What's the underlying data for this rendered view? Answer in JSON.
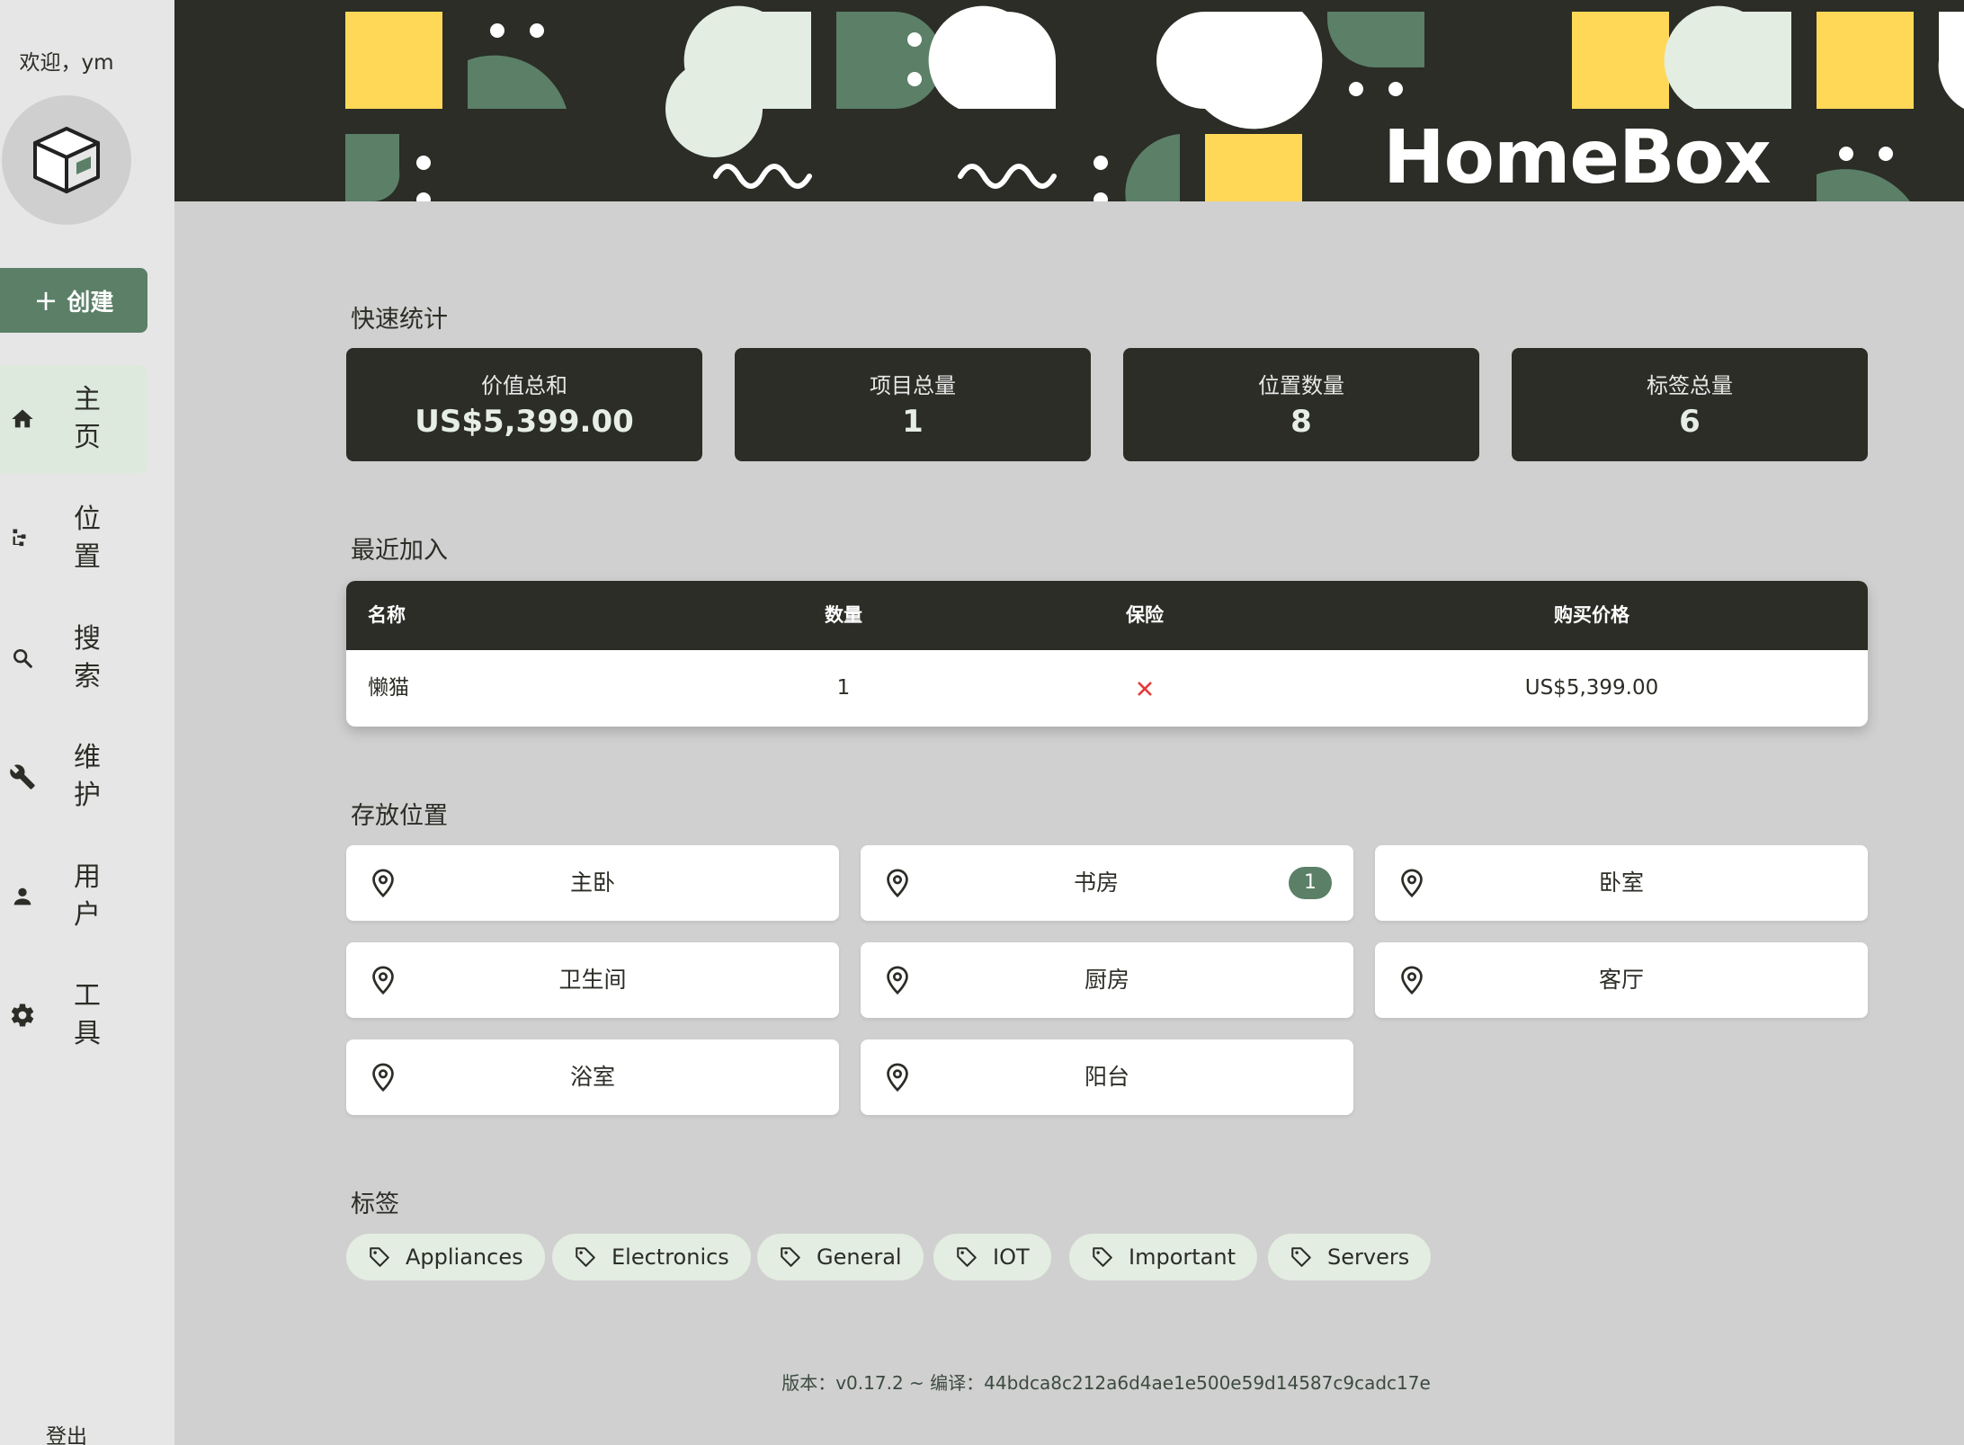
{
  "sidebar": {
    "welcome": "欢迎，ym",
    "create_label": "创建",
    "nav": [
      {
        "label": "主页",
        "icon": "home-icon",
        "active": true
      },
      {
        "label": "位置",
        "icon": "locations-tree-icon",
        "active": false
      },
      {
        "label": "搜索",
        "icon": "search-icon",
        "active": false
      },
      {
        "label": "维护",
        "icon": "wrench-icon",
        "active": false
      },
      {
        "label": "用户",
        "icon": "user-icon",
        "active": false
      },
      {
        "label": "工具",
        "icon": "gear-icon",
        "active": false
      }
    ],
    "logout": "登出"
  },
  "banner": {
    "brand": "HomeBox"
  },
  "sections": {
    "quick_stats": "快速统计",
    "recent": "最近加入",
    "locations": "存放位置",
    "labels": "标签"
  },
  "stats": [
    {
      "label": "价值总和",
      "value": "US$5,399.00"
    },
    {
      "label": "项目总量",
      "value": "1"
    },
    {
      "label": "位置数量",
      "value": "8"
    },
    {
      "label": "标签总量",
      "value": "6"
    }
  ],
  "recent_table": {
    "headers": [
      "名称",
      "数量",
      "保险",
      "购买价格"
    ],
    "rows": [
      {
        "name": "懒猫",
        "quantity": "1",
        "insured": false,
        "price": "US$5,399.00"
      }
    ]
  },
  "locations": [
    {
      "name": "主卧",
      "count": ""
    },
    {
      "name": "书房",
      "count": "1"
    },
    {
      "name": "卧室",
      "count": ""
    },
    {
      "name": "卫生间",
      "count": ""
    },
    {
      "name": "厨房",
      "count": ""
    },
    {
      "name": "客厅",
      "count": ""
    },
    {
      "name": "浴室",
      "count": ""
    },
    {
      "name": "阳台",
      "count": ""
    }
  ],
  "labels": [
    "Appliances",
    "Electronics",
    "General",
    "IOT",
    "Important",
    "Servers"
  ],
  "footer": "版本：v0.17.2 ~ 编译：44bdca8c212a6d4ae1e500e59d14587c9cadc17e",
  "colors": {
    "dark": "#2b2d26",
    "accent_green": "#5b7f67",
    "banner_yellow": "#ffd857",
    "light_mint": "#e3ede1",
    "error_red": "#e53935"
  }
}
